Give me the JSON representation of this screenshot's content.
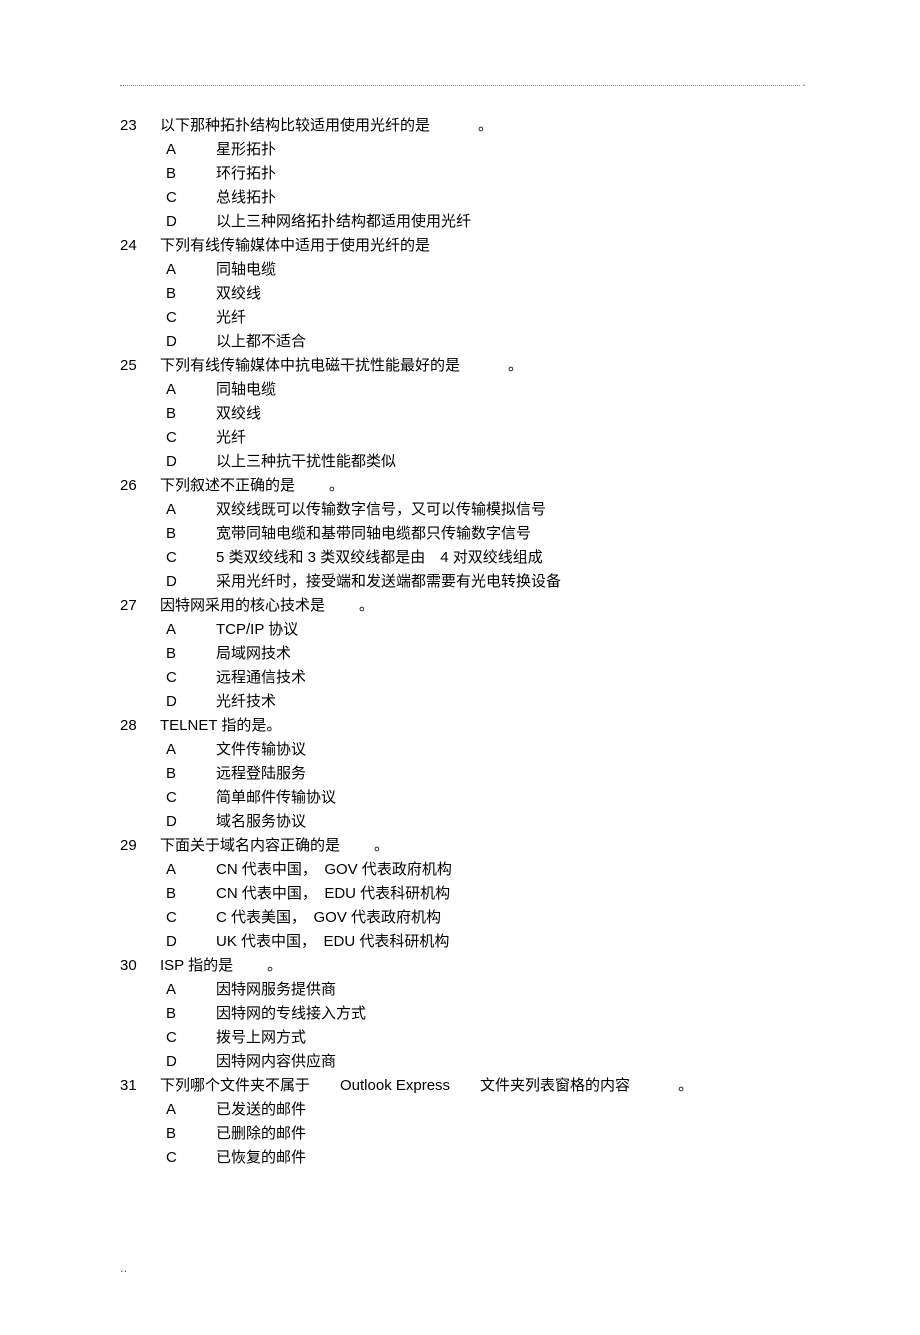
{
  "questions": [
    {
      "num": "23",
      "stem_pre": "以下那种拓扑结构比较适用使用光纤的是",
      "stem_post": "。",
      "choices": [
        {
          "l": "A",
          "t": "星形拓扑"
        },
        {
          "l": "B",
          "t": "环行拓扑"
        },
        {
          "l": "C",
          "t": "总线拓扑"
        },
        {
          "l": "D",
          "t": "以上三种网络拓扑结构都适用使用光纤"
        }
      ]
    },
    {
      "num": "24",
      "stem_pre": "下列有线传输媒体中适用于使用光纤的是",
      "stem_post": "",
      "choices": [
        {
          "l": "A",
          "t": "同轴电缆"
        },
        {
          "l": "B",
          "t": "双绞线"
        },
        {
          "l": "C",
          "t": "光纤"
        },
        {
          "l": "D",
          "t": "以上都不适合"
        }
      ]
    },
    {
      "num": "25",
      "stem_pre": "下列有线传输媒体中抗电磁干扰性能最好的是",
      "stem_post": "。",
      "choices": [
        {
          "l": "A",
          "t": "同轴电缆"
        },
        {
          "l": "B",
          "t": "双绞线"
        },
        {
          "l": "C",
          "t": "光纤"
        },
        {
          "l": "D",
          "t": "以上三种抗干扰性能都类似"
        }
      ]
    },
    {
      "num": "26",
      "stem_pre": "下列叙述不正确的是",
      "stem_post": "。",
      "short_gap": true,
      "choices": [
        {
          "l": "A",
          "t": "双绞线既可以传输数字信号，又可以传输模拟信号"
        },
        {
          "l": "B",
          "t": "宽带同轴电缆和基带同轴电缆都只传输数字信号"
        },
        {
          "l": "C",
          "t": "5 类双绞线和 3 类双绞线都是由　4 对双绞线组成"
        },
        {
          "l": "D",
          "t": "采用光纤时，接受端和发送端都需要有光电转换设备"
        }
      ]
    },
    {
      "num": "27",
      "stem_pre": "因特网采用的核心技术是",
      "stem_post": "。",
      "short_gap": true,
      "choices": [
        {
          "l": "A",
          "t": "TCP/IP 协议"
        },
        {
          "l": "B",
          "t": "局域网技术"
        },
        {
          "l": "C",
          "t": "远程通信技术"
        },
        {
          "l": "D",
          "t": "光纤技术"
        }
      ]
    },
    {
      "num": "28",
      "stem_pre": "TELNET 指的是。",
      "stem_post": "",
      "no_gap": true,
      "choices": [
        {
          "l": "A",
          "t": "文件传输协议"
        },
        {
          "l": "B",
          "t": "远程登陆服务"
        },
        {
          "l": "C",
          "t": "简单邮件传输协议"
        },
        {
          "l": "D",
          "t": "域名服务协议"
        }
      ]
    },
    {
      "num": "29",
      "stem_pre": "下面关于域名内容正确的是",
      "stem_post": "。",
      "short_gap": true,
      "choices": [
        {
          "l": "A",
          "t": "CN 代表中国，　GOV 代表政府机构"
        },
        {
          "l": "B",
          "t": "CN 代表中国，　EDU 代表科研机构"
        },
        {
          "l": "C",
          "t": "C 代表美国，　GOV 代表政府机构"
        },
        {
          "l": "D",
          "t": "UK 代表中国，　EDU 代表科研机构"
        }
      ]
    },
    {
      "num": "30",
      "stem_pre": "ISP 指的是",
      "stem_post": "。",
      "short_gap": true,
      "choices": [
        {
          "l": "A",
          "t": "因特网服务提供商"
        },
        {
          "l": "B",
          "t": "因特网的专线接入方式"
        },
        {
          "l": "C",
          "t": "拨号上网方式"
        },
        {
          "l": "D",
          "t": "因特网内容供应商"
        }
      ]
    },
    {
      "num": "31",
      "stem_pre": "下列哪个文件夹不属于　　Outlook Express　　文件夹列表窗格的内容",
      "stem_post": "。",
      "choices": [
        {
          "l": "A",
          "t": "已发送的邮件"
        },
        {
          "l": "B",
          "t": "已删除的邮件"
        },
        {
          "l": "C",
          "t": "已恢复的邮件"
        }
      ]
    }
  ],
  "footer": ".."
}
